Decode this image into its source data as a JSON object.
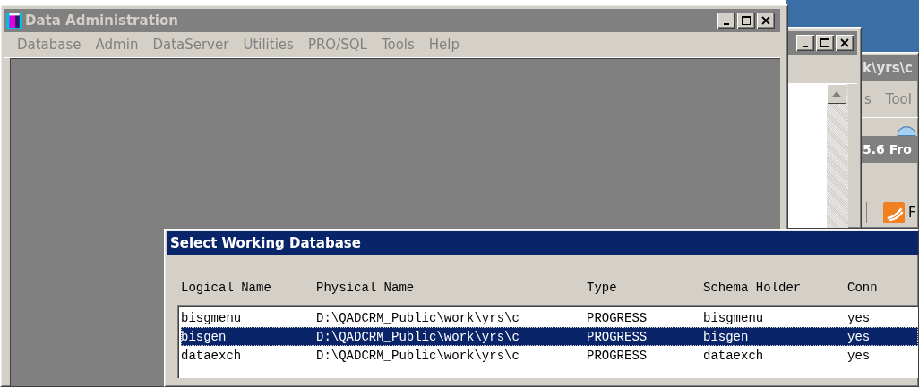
{
  "main_window": {
    "title": "Data Administration",
    "active": false,
    "menu": [
      {
        "label": "Database"
      },
      {
        "label": "Admin"
      },
      {
        "label": "DataServer"
      },
      {
        "label": "Utilities"
      },
      {
        "label": "PRO/SQL"
      },
      {
        "label": "Tools"
      },
      {
        "label": "Help"
      }
    ]
  },
  "back_window": {
    "title": "k\\yrs\\c",
    "menu": [
      {
        "label": "s"
      },
      {
        "label": "Tool"
      }
    ],
    "inner_title": "5.6 Fro",
    "item_label": "F"
  },
  "dialog": {
    "title": "Select Working Database",
    "active": true,
    "columns": [
      "Logical Name",
      "Physical Name",
      "Type",
      "Schema Holder",
      "Conn"
    ],
    "rows": [
      {
        "cells": [
          "bisgmenu",
          "D:\\QADCRM_Public\\work\\yrs\\c",
          "PROGRESS",
          "bisgmenu",
          "yes"
        ],
        "selected": false
      },
      {
        "cells": [
          "bisgen",
          "D:\\QADCRM_Public\\work\\yrs\\c",
          "PROGRESS",
          "bisgen",
          "yes"
        ],
        "selected": true
      },
      {
        "cells": [
          "dataexch",
          "D:\\QADCRM_Public\\work\\yrs\\c",
          "PROGRESS",
          "dataexch",
          "yes"
        ],
        "selected": false
      }
    ]
  }
}
